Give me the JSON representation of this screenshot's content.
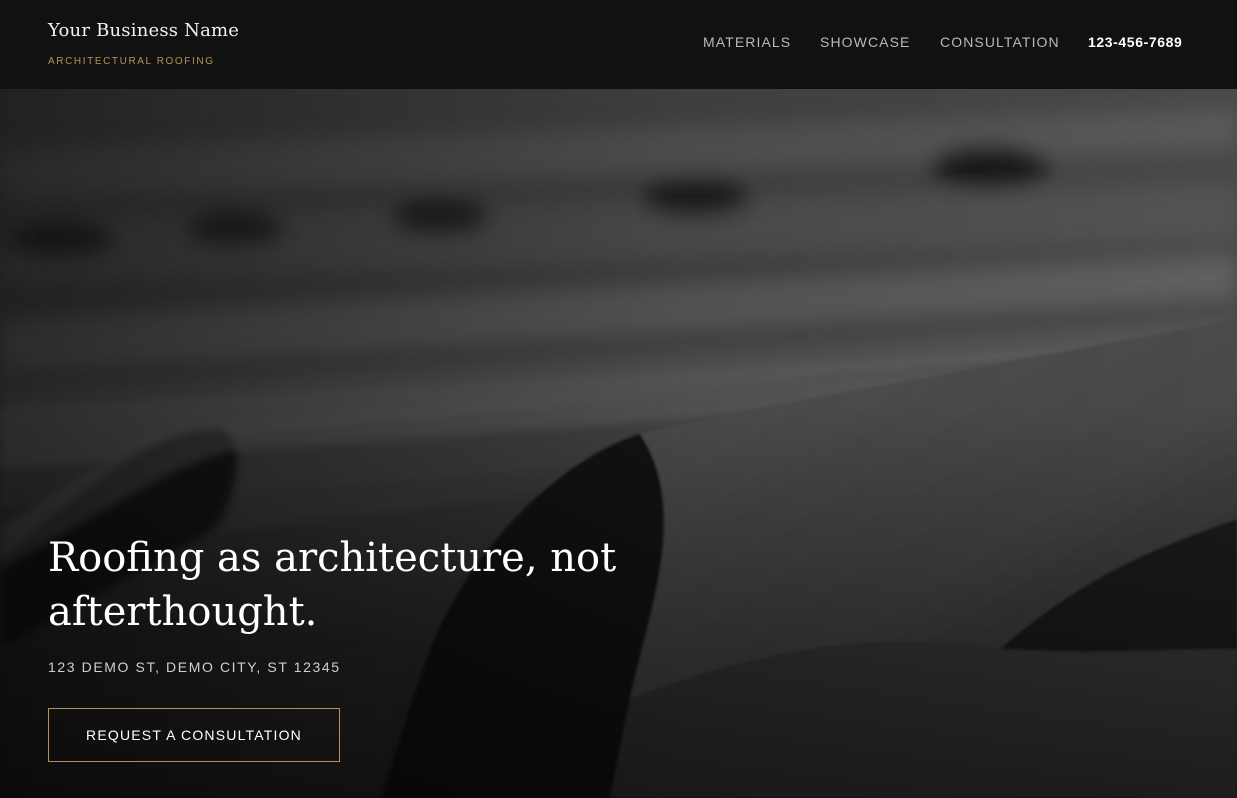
{
  "header": {
    "brand_name": "Your Business Name",
    "tagline": "ARCHITECTURAL ROOFING",
    "nav": {
      "materials": "MATERIALS",
      "showcase": "SHOWCASE",
      "consultation": "CONSULTATION"
    },
    "phone": "123-456-7689"
  },
  "hero": {
    "headline": "Roofing as architecture, not afterthought.",
    "address": "123 DEMO ST, DEMO CITY, ST 12345",
    "cta_label": "REQUEST A CONSULTATION"
  },
  "colors": {
    "header_bg": "#111111",
    "accent": "#b8915a",
    "nav_text": "#b9b9b9",
    "headline_text": "#ffffff"
  }
}
